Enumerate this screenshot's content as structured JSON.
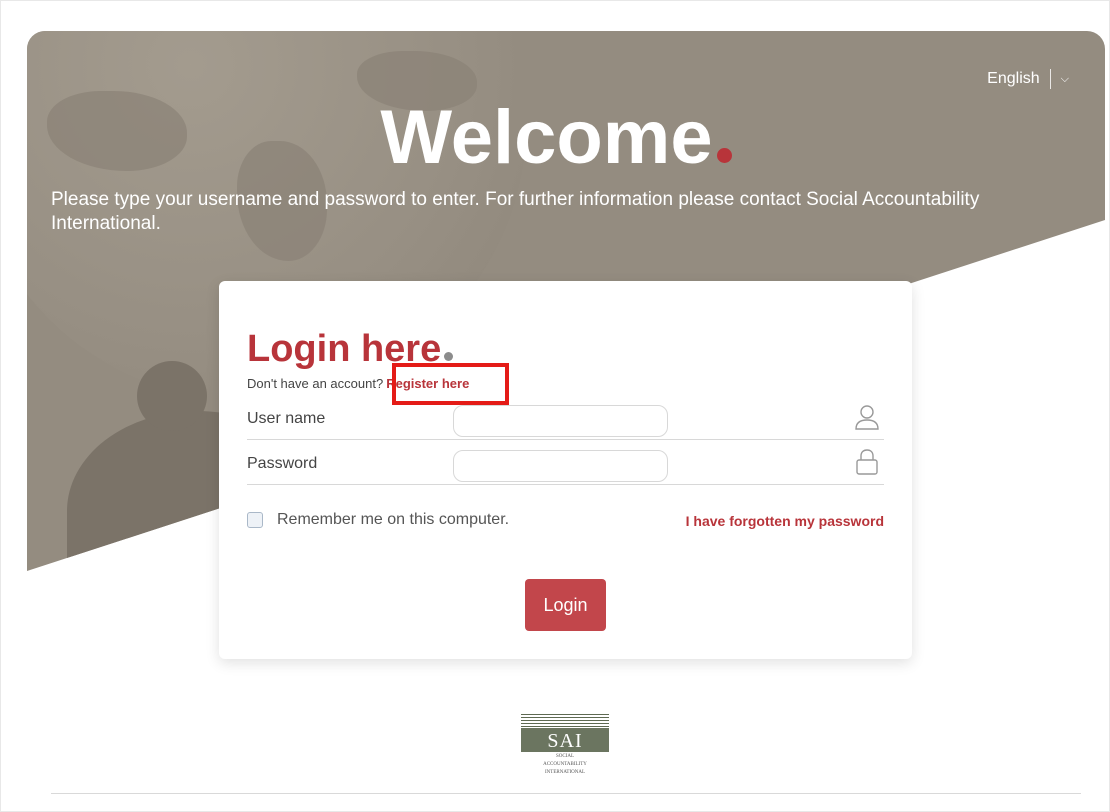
{
  "header": {
    "language": "English",
    "welcome_title": "Welcome",
    "intro_text": "Please type your username and password to enter. For further information please contact Social Accountability International."
  },
  "login": {
    "title": "Login here",
    "no_account_text": "Don't have an account?",
    "register_link": "Register here",
    "username_label": "User name",
    "username_value": "",
    "password_label": "Password",
    "password_value": "",
    "remember_label": "Remember me on this computer.",
    "remember_checked": false,
    "forgot_link": "I have forgotten my password",
    "login_button": "Login"
  },
  "logo": {
    "abbr": "SAI",
    "line1": "SOCIAL",
    "line2": "ACCOUNTABILITY",
    "line3": "INTERNATIONAL"
  },
  "colors": {
    "brand_red": "#b8343a",
    "hero_bg": "#948c80",
    "highlight_box": "#e41b17"
  },
  "icons": {
    "language": "chevron-down-icon",
    "username": "user-icon",
    "password": "lock-icon"
  }
}
